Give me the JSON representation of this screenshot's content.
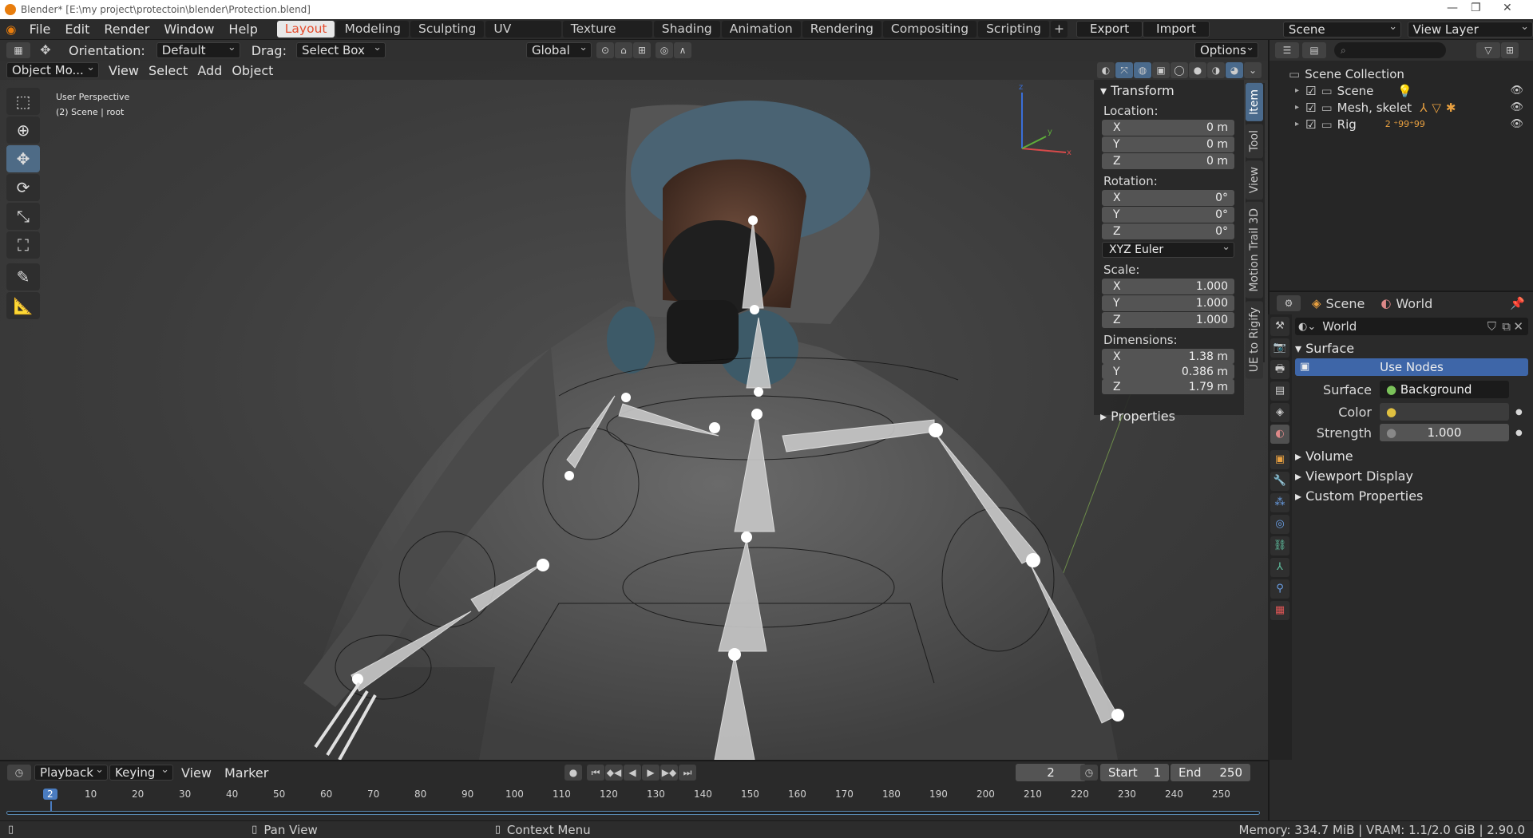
{
  "window": {
    "title": "Blender* [E:\\my project\\protectoin\\blender\\Protection.blend]"
  },
  "menubar": {
    "menus": [
      "File",
      "Edit",
      "Render",
      "Window",
      "Help"
    ],
    "workspaces": [
      "Layout",
      "Modeling",
      "Sculpting",
      "UV Editing",
      "Texture Paint",
      "Shading",
      "Animation",
      "Rendering",
      "Compositing",
      "Scripting"
    ],
    "active_workspace": "Layout",
    "export_label": "Export",
    "import_label": "Import",
    "scene_name": "Scene",
    "view_layer_name": "View Layer"
  },
  "viewport_header": {
    "orientation_label": "Orientation:",
    "orientation_value": "Default",
    "drag_label": "Drag:",
    "drag_value": "Select Box",
    "transform_space": "Global",
    "options_label": "Options",
    "mode": "Object Mo...",
    "menus": [
      "View",
      "Select",
      "Add",
      "Object"
    ]
  },
  "viewport_info": {
    "perspective": "User Perspective",
    "context": "(2) Scene | root"
  },
  "toolbar": {
    "tools": [
      "select-box-icon",
      "cursor-icon",
      "move-icon",
      "rotate-icon",
      "scale-icon",
      "transform-icon",
      "annotate-icon",
      "measure-icon"
    ],
    "active_index": 2
  },
  "npanel": {
    "transform_header": "Transform",
    "location_label": "Location:",
    "location": [
      {
        "axis": "X",
        "value": "0 m"
      },
      {
        "axis": "Y",
        "value": "0 m"
      },
      {
        "axis": "Z",
        "value": "0 m"
      }
    ],
    "rotation_label": "Rotation:",
    "rotation": [
      {
        "axis": "X",
        "value": "0°"
      },
      {
        "axis": "Y",
        "value": "0°"
      },
      {
        "axis": "Z",
        "value": "0°"
      }
    ],
    "rotation_mode": "XYZ Euler",
    "scale_label": "Scale:",
    "scale": [
      {
        "axis": "X",
        "value": "1.000"
      },
      {
        "axis": "Y",
        "value": "1.000"
      },
      {
        "axis": "Z",
        "value": "1.000"
      }
    ],
    "dimensions_label": "Dimensions:",
    "dimensions": [
      {
        "axis": "X",
        "value": "1.38 m"
      },
      {
        "axis": "Y",
        "value": "0.386 m"
      },
      {
        "axis": "Z",
        "value": "1.79 m"
      }
    ],
    "properties_header": "Properties",
    "tabs": [
      "Item",
      "Tool",
      "View",
      "Motion Trail 3D",
      "UE to Rigify"
    ],
    "active_tab": "Item"
  },
  "outliner": {
    "root": "Scene Collection",
    "items": [
      {
        "name": "Scene"
      },
      {
        "name": "Mesh, skelet"
      },
      {
        "name": "Rig",
        "extra": "2 ⁺99⁺99"
      }
    ]
  },
  "properties": {
    "breadcrumb_scene": "Scene",
    "breadcrumb_world": "World",
    "world_name": "World",
    "surface_header": "Surface",
    "use_nodes_label": "Use Nodes",
    "surface_label": "Surface",
    "surface_value": "Background",
    "color_label": "Color",
    "strength_label": "Strength",
    "strength_value": "1.000",
    "collapsed_sections": [
      "Volume",
      "Viewport Display",
      "Custom Properties"
    ]
  },
  "timeline": {
    "playback_label": "Playback",
    "keying_label": "Keying",
    "view_label": "View",
    "marker_label": "Marker",
    "current_frame": "2",
    "start_label": "Start",
    "start_value": "1",
    "end_label": "End",
    "end_value": "250",
    "ruler_ticks": [
      "2",
      "10",
      "20",
      "30",
      "40",
      "50",
      "60",
      "70",
      "80",
      "90",
      "100",
      "110",
      "120",
      "130",
      "140",
      "150",
      "160",
      "170",
      "180",
      "190",
      "200",
      "210",
      "220",
      "230",
      "240",
      "250"
    ]
  },
  "statusbar": {
    "pan_view": "Pan View",
    "context_menu": "Context Menu",
    "memory": "Memory: 334.7 MiB | VRAM: 1.1/2.0 GiB | 2.90.0"
  },
  "colors": {
    "accent_active_tab": "#e54d2e",
    "selection_blue": "#4a6a8c",
    "use_nodes_blue": "#3e66a8"
  }
}
